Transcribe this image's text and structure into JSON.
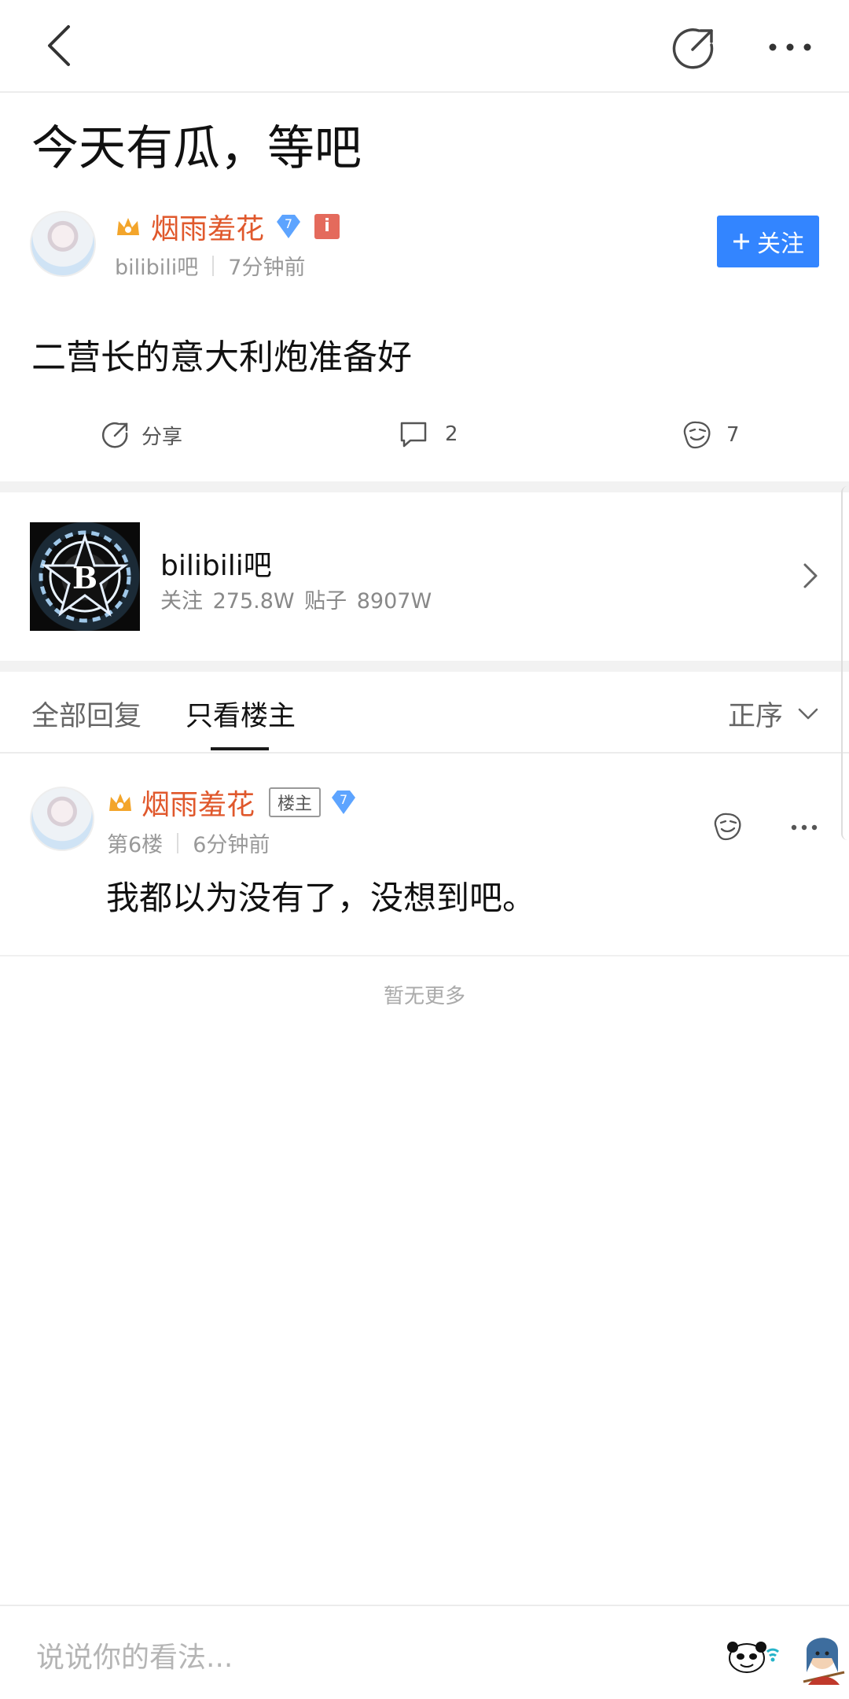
{
  "post": {
    "title": "今天有瓜，等吧",
    "author": "烟雨羞花",
    "level": "7",
    "forum_name": "bilibili吧",
    "time": "7分钟前",
    "follow_label": "关注",
    "body": "二营长的意大利炮准备好",
    "actions": {
      "share_label": "分享",
      "comment_count": "2",
      "like_count": "7"
    }
  },
  "forum": {
    "name": "bilibili吧",
    "stats": "关注 275.8W   贴子 8907W",
    "logo_letter": "B"
  },
  "tabs": {
    "all_replies": "全部回复",
    "only_op": "只看楼主",
    "sort": "正序"
  },
  "reply": {
    "author": "烟雨羞花",
    "op_badge": "楼主",
    "level": "7",
    "floor": "第6楼",
    "time": "6分钟前",
    "body": "我都以为没有了，没想到吧。"
  },
  "footer": {
    "no_more": "暂无更多",
    "comment_placeholder": "说说你的看法..."
  },
  "colors": {
    "accent": "#3385ff",
    "author": "#e0582c"
  },
  "icons": [
    "back-icon",
    "share-icon",
    "more-icon",
    "crown-icon",
    "diamond-icon",
    "info-icon",
    "plus-icon",
    "comment-icon",
    "like-icon",
    "chevron-right-icon",
    "chevron-down-icon",
    "emoji-icon"
  ]
}
